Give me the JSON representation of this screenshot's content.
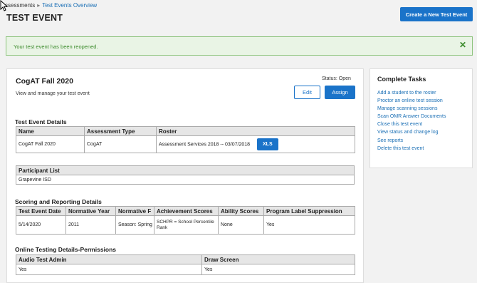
{
  "breadcrumb": {
    "item1": "ssessments",
    "separator": "▸",
    "item2": "Test Events Overview"
  },
  "page_title": "TEST EVENT",
  "create_button": "Create a New Test Event",
  "alert": {
    "message": "Your test event has been reopened.",
    "close": "✕"
  },
  "event": {
    "name": "CogAT Fall 2020",
    "subtitle": "View and manage your test event",
    "status_label": "Status:",
    "status_value": "Open",
    "edit_label": "Edit",
    "assign_label": "Assign"
  },
  "test_event_details": {
    "title": "Test Event Details",
    "headers": [
      "Name",
      "Assessment Type",
      "Roster"
    ],
    "row": [
      "CogAT Fall 2020",
      "CogAT",
      "Assessment Services 2018 -- 03/07/2018"
    ],
    "xls_label": "XLS"
  },
  "participant_list": {
    "header": "Participant List",
    "value": "Grapevine ISD"
  },
  "scoring": {
    "title": "Scoring and Reporting Details",
    "headers": [
      "Test Event Date",
      "Normative Year",
      "Normative F",
      "Achievement Scores",
      "Ability Scores",
      "Program Label Suppression"
    ],
    "row": [
      "5/14/2020",
      "2011",
      "Season: Spring",
      "SCHPR = School Percentile Rank",
      "None",
      "Yes"
    ]
  },
  "online": {
    "title": "Online Testing Details-Permissions",
    "headers": [
      "Audio Test Admin",
      "Draw Screen"
    ],
    "row": [
      "Yes",
      "Yes"
    ]
  },
  "tasks": {
    "title": "Complete Tasks",
    "items": [
      "Add a student to the roster",
      "Proctor an online test session",
      "Manage scanning sessions",
      "Scan OMR Answer Documents",
      "Close this test event",
      "View status and change log",
      "See reports",
      "Delete this test event"
    ]
  },
  "colors": {
    "primary": "#1a73c9",
    "link": "#1a6fb5",
    "success_bg": "#e9f4e5",
    "success_text": "#3a8a2a"
  }
}
